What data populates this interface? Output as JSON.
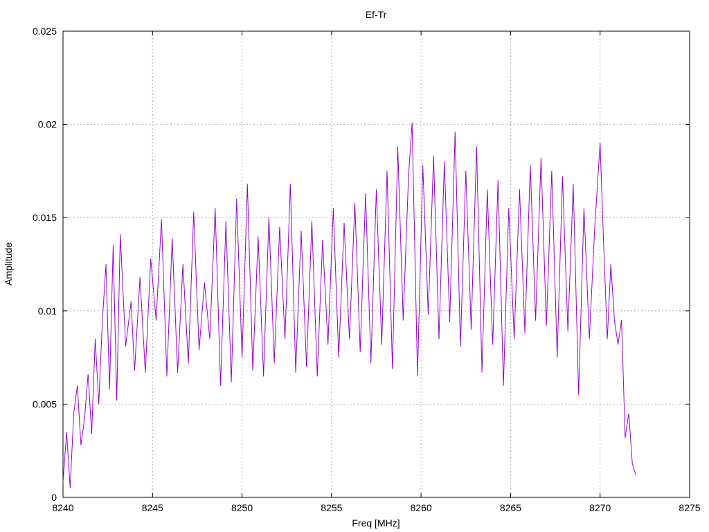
{
  "chart_data": {
    "type": "line",
    "title": "Ef-Tr",
    "xlabel": "Freq [MHz]",
    "ylabel": "Amplitude",
    "xlim": [
      8240,
      8275
    ],
    "ylim": [
      0,
      0.025
    ],
    "xticks": [
      8240,
      8245,
      8250,
      8255,
      8260,
      8265,
      8270,
      8275
    ],
    "yticks": [
      0,
      0.005,
      0.01,
      0.015,
      0.02,
      0.025
    ],
    "xtick_labels": [
      "8240",
      "8245",
      "8250",
      "8255",
      "8260",
      "8265",
      "8270",
      "8275"
    ],
    "ytick_labels": [
      "0",
      "0.005",
      "0.01",
      "0.015",
      "0.02",
      "0.025"
    ],
    "grid": true,
    "legend": "none",
    "series": [
      {
        "color": "#9400d3",
        "x": [
          8240.0,
          8240.2,
          8240.4,
          8240.6,
          8240.8,
          8241.0,
          8241.2,
          8241.4,
          8241.6,
          8241.8,
          8242.0,
          8242.2,
          8242.4,
          8242.6,
          8242.8,
          8243.0,
          8243.2,
          8243.5,
          8243.8,
          8244.0,
          8244.3,
          8244.6,
          8244.9,
          8245.2,
          8245.5,
          8245.8,
          8246.1,
          8246.4,
          8246.7,
          8247.0,
          8247.3,
          8247.6,
          8247.9,
          8248.2,
          8248.5,
          8248.8,
          8249.1,
          8249.4,
          8249.7,
          8250.0,
          8250.3,
          8250.6,
          8250.9,
          8251.2,
          8251.5,
          8251.8,
          8252.1,
          8252.4,
          8252.7,
          8253.0,
          8253.3,
          8253.6,
          8253.9,
          8254.2,
          8254.5,
          8254.8,
          8255.1,
          8255.4,
          8255.7,
          8256.0,
          8256.3,
          8256.6,
          8256.9,
          8257.2,
          8257.5,
          8257.8,
          8258.1,
          8258.4,
          8258.7,
          8259.0,
          8259.3,
          8259.5,
          8259.8,
          8260.1,
          8260.4,
          8260.7,
          8261.0,
          8261.3,
          8261.6,
          8261.9,
          8262.2,
          8262.5,
          8262.8,
          8263.1,
          8263.4,
          8263.7,
          8264.0,
          8264.3,
          8264.6,
          8264.9,
          8265.2,
          8265.5,
          8265.8,
          8266.1,
          8266.4,
          8266.7,
          8267.0,
          8267.3,
          8267.6,
          8267.9,
          8268.2,
          8268.5,
          8268.8,
          8269.1,
          8269.4,
          8269.7,
          8270.0,
          8270.2,
          8270.4,
          8270.6,
          8270.8,
          8271.0,
          8271.2,
          8271.4,
          8271.6,
          8271.8,
          8272.0
        ],
        "y": [
          0.0008,
          0.0035,
          0.0005,
          0.0045,
          0.006,
          0.0028,
          0.0042,
          0.0066,
          0.0034,
          0.0085,
          0.005,
          0.0095,
          0.0125,
          0.0058,
          0.0135,
          0.0052,
          0.0141,
          0.0081,
          0.0105,
          0.0068,
          0.0118,
          0.0067,
          0.0128,
          0.0095,
          0.0149,
          0.0065,
          0.0139,
          0.0067,
          0.0125,
          0.0072,
          0.0153,
          0.0079,
          0.0115,
          0.0085,
          0.0155,
          0.006,
          0.0148,
          0.0062,
          0.016,
          0.0075,
          0.0168,
          0.0068,
          0.014,
          0.0065,
          0.015,
          0.0072,
          0.0145,
          0.0085,
          0.0168,
          0.0067,
          0.0143,
          0.007,
          0.0148,
          0.0065,
          0.0138,
          0.0082,
          0.0155,
          0.0075,
          0.0147,
          0.0085,
          0.0158,
          0.0078,
          0.0163,
          0.0072,
          0.0165,
          0.0082,
          0.0175,
          0.0069,
          0.0188,
          0.0095,
          0.0172,
          0.0201,
          0.0065,
          0.0178,
          0.0098,
          0.0183,
          0.0085,
          0.018,
          0.0094,
          0.0196,
          0.0081,
          0.0175,
          0.009,
          0.0188,
          0.0067,
          0.0165,
          0.0082,
          0.017,
          0.006,
          0.0155,
          0.0085,
          0.0165,
          0.0088,
          0.0178,
          0.0095,
          0.0182,
          0.0092,
          0.0175,
          0.0075,
          0.0172,
          0.0089,
          0.0168,
          0.0055,
          0.0155,
          0.0085,
          0.0145,
          0.019,
          0.0135,
          0.0085,
          0.0125,
          0.0095,
          0.0082,
          0.0095,
          0.0032,
          0.0045,
          0.0018,
          0.0012
        ]
      }
    ]
  }
}
